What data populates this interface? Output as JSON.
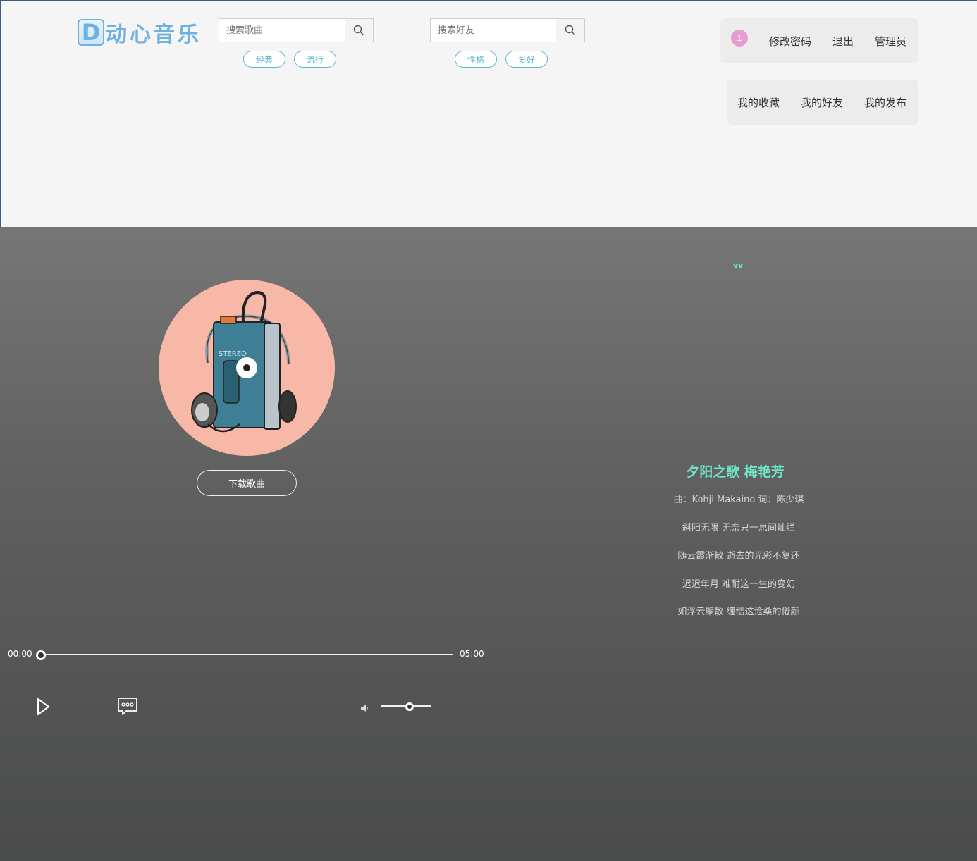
{
  "header": {
    "logo_letter": "D",
    "logo_text": "动心音乐",
    "song_search": {
      "placeholder": "搜索歌曲",
      "tags": [
        "经典",
        "流行"
      ]
    },
    "friend_search": {
      "placeholder": "搜索好友",
      "tags": [
        "性格",
        "爱好"
      ]
    },
    "user_panel": {
      "badge": "1",
      "change_password": "修改密码",
      "logout": "退出",
      "admin": "管理员"
    },
    "my_panel": {
      "favorites": "我的收藏",
      "friends": "我的好友",
      "posts": "我的发布"
    }
  },
  "player": {
    "download_label": "下载歌曲",
    "current_time": "00:00",
    "duration": "05:00",
    "progress": 0,
    "volume": 0.58,
    "icons": {
      "play": "play-icon",
      "comment": "comment-icon",
      "volume": "volume-icon"
    }
  },
  "lyrics": {
    "top_marker": "xx",
    "title": "夕阳之歌 梅艳芳",
    "lines": [
      "曲：Kohji Makaino 词：陈少琪",
      "斜阳无限 无奈只一息间灿烂",
      "随云霞渐散 逝去的光彩不复还",
      "迟迟年月 难耐这一生的变幻",
      "如浮云聚散 缠结这沧桑的倦颜"
    ]
  },
  "colors": {
    "accent": "#6fe6c8",
    "logo": "#6fb1e0",
    "tag": "#5fb7cf",
    "badge": "#e59ccf",
    "cover_bg": "#f7b8a8"
  }
}
